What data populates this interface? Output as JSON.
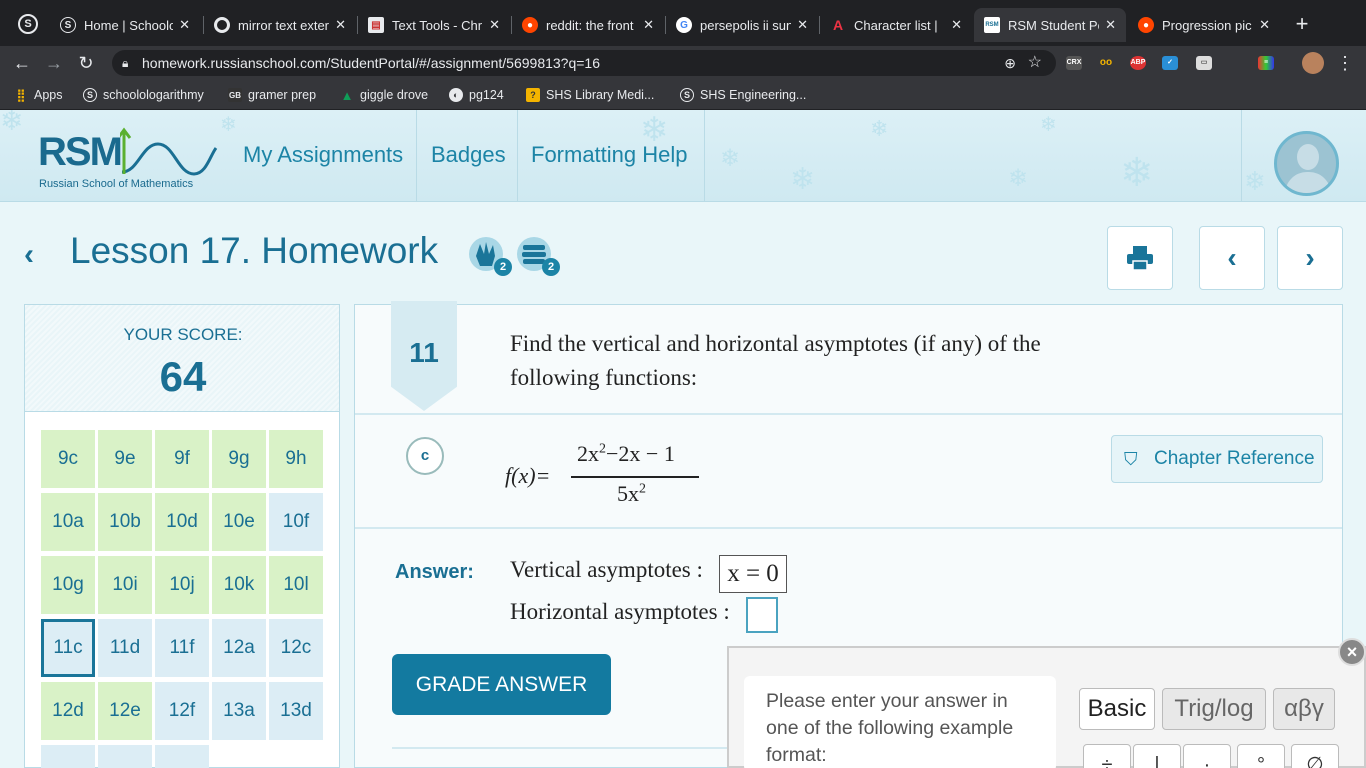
{
  "browser": {
    "tabs": [
      {
        "title": "Home | Schoolo",
        "active": false
      },
      {
        "title": "mirror text exter",
        "active": false
      },
      {
        "title": "Text Tools - Chr",
        "active": false
      },
      {
        "title": "reddit: the front",
        "active": false
      },
      {
        "title": "persepolis ii sun",
        "active": false
      },
      {
        "title": "Character list | ",
        "active": false
      },
      {
        "title": "RSM Student Po",
        "active": true
      },
      {
        "title": "Progression pic",
        "active": false
      }
    ],
    "new_tab": "+",
    "url": "homework.russianschool.com/StudentPortal/#/assignment/5699813?q=16",
    "bookmarks": [
      "Apps",
      "schoolologarithmy",
      "gramer prep",
      "giggle drove",
      "pg124",
      "SHS Library Medi...",
      "SHS Engineering..."
    ]
  },
  "site": {
    "logo_text": "RSM",
    "logo_subtitle": "Russian School of Mathematics",
    "nav": [
      "My Assignments",
      "Badges",
      "Formatting Help"
    ]
  },
  "lesson": {
    "title": "Lesson 17. Homework",
    "badge_counts": [
      "2",
      "2"
    ]
  },
  "score": {
    "label": "YOUR SCORE:",
    "value": "64"
  },
  "problems": [
    {
      "label": "9c",
      "status": "done"
    },
    {
      "label": "9e",
      "status": "done"
    },
    {
      "label": "9f",
      "status": "done"
    },
    {
      "label": "9g",
      "status": "done"
    },
    {
      "label": "9h",
      "status": "done"
    },
    {
      "label": "10a",
      "status": "done"
    },
    {
      "label": "10b",
      "status": "done"
    },
    {
      "label": "10d",
      "status": "done"
    },
    {
      "label": "10e",
      "status": "done"
    },
    {
      "label": "10f",
      "status": "open"
    },
    {
      "label": "10g",
      "status": "done"
    },
    {
      "label": "10i",
      "status": "done"
    },
    {
      "label": "10j",
      "status": "done"
    },
    {
      "label": "10k",
      "status": "done"
    },
    {
      "label": "10l",
      "status": "done"
    },
    {
      "label": "11c",
      "status": "current"
    },
    {
      "label": "11d",
      "status": "open"
    },
    {
      "label": "11f",
      "status": "open"
    },
    {
      "label": "12a",
      "status": "open"
    },
    {
      "label": "12c",
      "status": "open"
    },
    {
      "label": "12d",
      "status": "done"
    },
    {
      "label": "12e",
      "status": "done"
    },
    {
      "label": "12f",
      "status": "open"
    },
    {
      "label": "13a",
      "status": "open"
    },
    {
      "label": "13d",
      "status": "open"
    }
  ],
  "question": {
    "number": "11",
    "text_line1": "Find the vertical and horizontal asymptotes (if any) of the",
    "text_line2": "following functions:",
    "part": "c",
    "func_lhs": "f(x)=",
    "func_num_a": "2x",
    "func_num_exp": "2",
    "func_num_b": "−2x − 1",
    "func_den_a": "5x",
    "func_den_exp": "2",
    "chapter_reference": "Chapter Reference",
    "answer_label": "Answer:",
    "vertical_label": "Vertical asymptotes :",
    "vertical_value": "x = 0",
    "horizontal_label": "Horizontal asymptotes :",
    "horizontal_value": "",
    "grade_button": "GRADE ANSWER"
  },
  "keypad": {
    "hint": "Please enter your answer in one of the following example format:",
    "tabs": [
      "Basic",
      "Trig/log",
      "αβγ"
    ],
    "active_tab": "Basic",
    "keys": [
      "÷",
      "|",
      "·",
      "°",
      "∅"
    ],
    "close": "×"
  },
  "colors": {
    "brand": "#1a6f93",
    "button": "#137aa0",
    "done_cell": "#d9f2c7",
    "open_cell": "#dcedf5"
  }
}
